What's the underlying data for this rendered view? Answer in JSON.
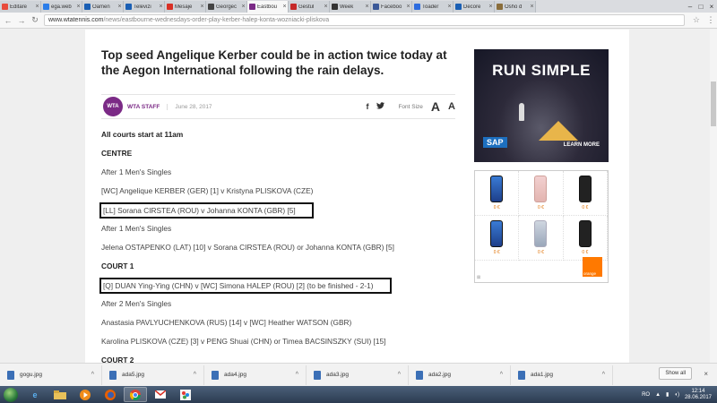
{
  "browser": {
    "tabs": [
      {
        "title": "Editare",
        "color": "#e84b3c"
      },
      {
        "title": "ega.web",
        "color": "#2b7de9"
      },
      {
        "title": "Oamen",
        "color": "#1a5fb4"
      },
      {
        "title": "Televizi",
        "color": "#1a5fb4"
      },
      {
        "title": "Mesaje",
        "color": "#d93025"
      },
      {
        "title": "Georgec",
        "color": "#444444"
      },
      {
        "title": "Eastbou",
        "color": "#7b2a86",
        "active": true
      },
      {
        "title": "Gestul",
        "color": "#c62828"
      },
      {
        "title": "Week",
        "color": "#333333"
      },
      {
        "title": "Faceboo",
        "color": "#3b5998"
      },
      {
        "title": "Toader",
        "color": "#2d6cdf"
      },
      {
        "title": "Decore",
        "color": "#1a5fb4"
      },
      {
        "title": "Osho d",
        "color": "#8a6d3b"
      }
    ],
    "url_host": "www.wtatennis.com",
    "url_path": "/news/eastbourne-wednesdays-order-play-kerber-halep-konta-wozniacki-pliskova"
  },
  "article": {
    "headline": "Top seed Angelique Kerber could be in action twice today at the Aegon International following the rain delays.",
    "logo_text": "WTA",
    "author": "WTA STAFF",
    "date": "June 28, 2017",
    "font_size_label": "Font Size",
    "font_a_large": "A",
    "font_a_small": "A",
    "lines": [
      "All courts start at 11am",
      "CENTRE",
      "After 1 Men's Singles",
      "[WC] Angelique KERBER (GER) [1] v Kristyna PLISKOVA (CZE)",
      "[LL] Sorana CIRSTEA (ROU) v Johanna KONTA (GBR) [5]",
      "After 1 Men's Singles",
      "Jelena OSTAPENKO (LAT) [10] v Sorana CIRSTEA (ROU) or Johanna KONTA (GBR) [5]",
      "COURT 1",
      "[Q] DUAN Ying-Ying (CHN) v [WC] Simona HALEP (ROU) [2] (to be finished - 2-1)",
      "After 2 Men's Singles",
      "Anastasia PAVLYUCHENKOVA (RUS) [14] v [WC] Heather WATSON (GBR)",
      "Karolina PLISKOVA (CZE) [3] v PENG Shuai (CHN) or Timea BACSINSZKY (SUI) [15]",
      "COURT 2"
    ]
  },
  "ads": {
    "sap": {
      "headline": "RUN SIMPLE",
      "brand": "SAP",
      "cta": "LEARN MORE"
    },
    "orange": {
      "prices": [
        "0 €",
        "0 €",
        "0 €",
        "0 €",
        "0 €",
        "0 €"
      ],
      "brand": "orange"
    }
  },
  "downloads": {
    "items": [
      "gogu.jpg",
      "ada5.jpg",
      "ada4.jpg",
      "ada3.jpg",
      "ada2.jpg",
      "ada1.jpg"
    ],
    "show_all": "Show all"
  },
  "taskbar": {
    "lang": "RO",
    "time": "12:14",
    "date": "28.06.2017"
  }
}
